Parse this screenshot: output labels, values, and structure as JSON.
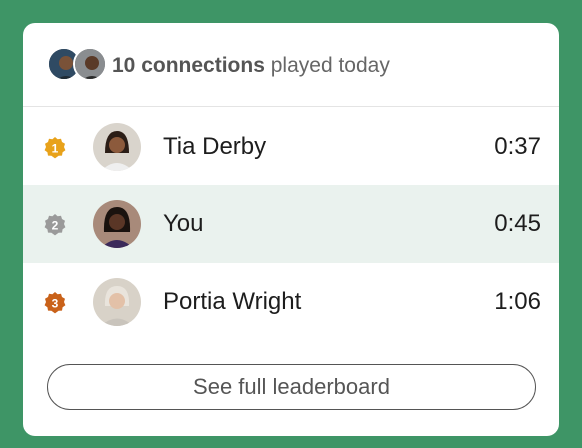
{
  "header": {
    "connections_count": "10 connections",
    "suffix": "played today"
  },
  "leaderboard": [
    {
      "rank": "1",
      "name": "Tia Derby",
      "time": "0:37",
      "medal_color": "#e8a21a"
    },
    {
      "rank": "2",
      "name": "You",
      "time": "0:45",
      "medal_color": "#9a9a9a"
    },
    {
      "rank": "3",
      "name": "Portia Wright",
      "time": "1:06",
      "medal_color": "#c9621a"
    }
  ],
  "button": {
    "label": "See full leaderboard"
  },
  "colors": {
    "background": "#3e9566",
    "highlight_row": "#eaf2ee"
  }
}
